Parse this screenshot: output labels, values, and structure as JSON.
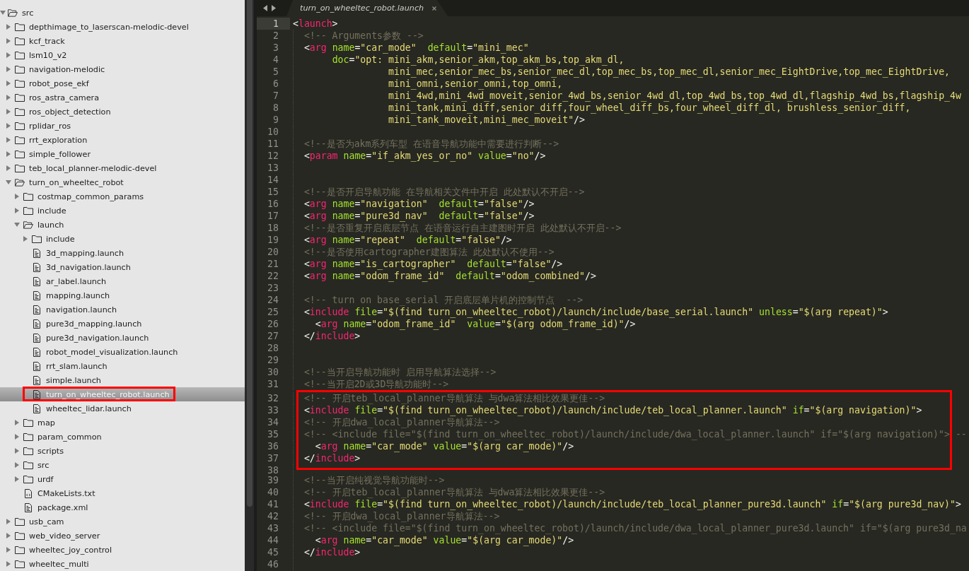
{
  "sidebar": {
    "items": [
      {
        "label": "src",
        "kind": "folder",
        "expanded": true,
        "selected": false,
        "highlighted": false,
        "children": [
          {
            "label": "depthimage_to_laserscan-melodic-devel",
            "kind": "folder",
            "expanded": false,
            "selected": false,
            "highlighted": false
          },
          {
            "label": "kcf_track",
            "kind": "folder",
            "expanded": false,
            "selected": false,
            "highlighted": false
          },
          {
            "label": "lsm10_v2",
            "kind": "folder",
            "expanded": false,
            "selected": false,
            "highlighted": false
          },
          {
            "label": "navigation-melodic",
            "kind": "folder",
            "expanded": false,
            "selected": false,
            "highlighted": false
          },
          {
            "label": "robot_pose_ekf",
            "kind": "folder",
            "expanded": false,
            "selected": false,
            "highlighted": false
          },
          {
            "label": "ros_astra_camera",
            "kind": "folder",
            "expanded": false,
            "selected": false,
            "highlighted": false
          },
          {
            "label": "ros_object_detection",
            "kind": "folder",
            "expanded": false,
            "selected": false,
            "highlighted": false
          },
          {
            "label": "rplidar_ros",
            "kind": "folder",
            "expanded": false,
            "selected": false,
            "highlighted": false
          },
          {
            "label": "rrt_exploration",
            "kind": "folder",
            "expanded": false,
            "selected": false,
            "highlighted": false
          },
          {
            "label": "simple_follower",
            "kind": "folder",
            "expanded": false,
            "selected": false,
            "highlighted": false
          },
          {
            "label": "teb_local_planner-melodic-devel",
            "kind": "folder",
            "expanded": false,
            "selected": false,
            "highlighted": false
          },
          {
            "label": "turn_on_wheeltec_robot",
            "kind": "folder",
            "expanded": true,
            "selected": false,
            "highlighted": false,
            "children": [
              {
                "label": "costmap_common_params",
                "kind": "folder",
                "expanded": false,
                "selected": false,
                "highlighted": false
              },
              {
                "label": "include",
                "kind": "folder",
                "expanded": false,
                "selected": false,
                "highlighted": false
              },
              {
                "label": "launch",
                "kind": "folder",
                "expanded": true,
                "selected": false,
                "highlighted": false,
                "children": [
                  {
                    "label": "include",
                    "kind": "folder",
                    "expanded": false,
                    "selected": false,
                    "highlighted": false
                  },
                  {
                    "label": "3d_mapping.launch",
                    "kind": "file",
                    "selected": false,
                    "highlighted": false
                  },
                  {
                    "label": "3d_navigation.launch",
                    "kind": "file",
                    "selected": false,
                    "highlighted": false
                  },
                  {
                    "label": "ar_label.launch",
                    "kind": "file",
                    "selected": false,
                    "highlighted": false
                  },
                  {
                    "label": "mapping.launch",
                    "kind": "file",
                    "selected": false,
                    "highlighted": false
                  },
                  {
                    "label": "navigation.launch",
                    "kind": "file",
                    "selected": false,
                    "highlighted": false
                  },
                  {
                    "label": "pure3d_mapping.launch",
                    "kind": "file",
                    "selected": false,
                    "highlighted": false
                  },
                  {
                    "label": "pure3d_navigation.launch",
                    "kind": "file",
                    "selected": false,
                    "highlighted": false
                  },
                  {
                    "label": "robot_model_visualization.launch",
                    "kind": "file",
                    "selected": false,
                    "highlighted": false
                  },
                  {
                    "label": "rrt_slam.launch",
                    "kind": "file",
                    "selected": false,
                    "highlighted": false
                  },
                  {
                    "label": "simple.launch",
                    "kind": "file",
                    "selected": false,
                    "highlighted": false
                  },
                  {
                    "label": "turn_on_wheeltec_robot.launch",
                    "kind": "file",
                    "selected": true,
                    "highlighted": true
                  },
                  {
                    "label": "wheeltec_lidar.launch",
                    "kind": "file",
                    "selected": false,
                    "highlighted": false
                  }
                ]
              },
              {
                "label": "map",
                "kind": "folder",
                "expanded": false,
                "selected": false,
                "highlighted": false
              },
              {
                "label": "param_common",
                "kind": "folder",
                "expanded": false,
                "selected": false,
                "highlighted": false
              },
              {
                "label": "scripts",
                "kind": "folder",
                "expanded": false,
                "selected": false,
                "highlighted": false
              },
              {
                "label": "src",
                "kind": "folder",
                "expanded": false,
                "selected": false,
                "highlighted": false
              },
              {
                "label": "urdf",
                "kind": "folder",
                "expanded": false,
                "selected": false,
                "highlighted": false
              },
              {
                "label": "CMakeLists.txt",
                "kind": "code-file",
                "selected": false,
                "highlighted": false
              },
              {
                "label": "package.xml",
                "kind": "file",
                "selected": false,
                "highlighted": false
              }
            ]
          },
          {
            "label": "usb_cam",
            "kind": "folder",
            "expanded": false,
            "selected": false,
            "highlighted": false
          },
          {
            "label": "web_video_server",
            "kind": "folder",
            "expanded": false,
            "selected": false,
            "highlighted": false
          },
          {
            "label": "wheeltec_joy_control",
            "kind": "folder",
            "expanded": false,
            "selected": false,
            "highlighted": false
          },
          {
            "label": "wheeltec_multi",
            "kind": "folder",
            "expanded": false,
            "selected": false,
            "highlighted": false
          }
        ]
      }
    ]
  },
  "editor": {
    "tabs": [
      {
        "title": "turn_on_wheeltec_robot.launch",
        "selected": true
      }
    ],
    "blocks": [
      {
        "highlighted": false,
        "lines": [
          {
            "number": "1",
            "kind": "code",
            "text": "<launch>",
            "current": true
          },
          {
            "number": "2",
            "kind": "comment",
            "text": "  <!-- Arguments参数 -->",
            "current": false
          },
          {
            "number": "3",
            "kind": "code",
            "text": "  <arg name=\"car_mode\"  default=\"mini_mec\"",
            "current": false
          },
          {
            "number": "4",
            "kind": "code",
            "text": "       doc=\"opt: mini_akm,senior_akm,top_akm_bs,top_akm_dl,",
            "current": false
          },
          {
            "number": "5",
            "kind": "code",
            "text": "                 mini_mec,senior_mec_bs,senior_mec_dl,top_mec_bs,top_mec_dl,senior_mec_EightDrive,top_mec_EightDrive,",
            "current": false
          },
          {
            "number": "6",
            "kind": "code",
            "text": "                 mini_omni,senior_omni,top_omni,",
            "current": false
          },
          {
            "number": "7",
            "kind": "code",
            "text": "                 mini_4wd,mini_4wd_moveit,senior_4wd_bs,senior_4wd_dl,top_4wd_bs,top_4wd_dl,flagship_4wd_bs,flagship_4w",
            "current": false
          },
          {
            "number": "8",
            "kind": "code",
            "text": "                 mini_tank,mini_diff,senior_diff,four_wheel_diff_bs,four_wheel_diff_dl, brushless_senior_diff,",
            "current": false
          },
          {
            "number": "9",
            "kind": "code",
            "text": "                 mini_tank_moveit,mini_mec_moveit\"/>",
            "current": false
          },
          {
            "number": "10",
            "kind": "blank",
            "current": false
          },
          {
            "number": "11",
            "kind": "comment",
            "text": "  <!--是否为akm系列车型 在语音导航功能中需要进行判断-->",
            "current": false
          },
          {
            "number": "12",
            "kind": "code",
            "text": "  <param name=\"if_akm_yes_or_no\" value=\"no\"/>",
            "current": false
          },
          {
            "number": "13",
            "kind": "blank",
            "current": false
          },
          {
            "number": "14",
            "kind": "blank",
            "current": false
          },
          {
            "number": "15",
            "kind": "comment",
            "text": "  <!--是否开启导航功能 在导航相关文件中开启 此处默认不开启-->",
            "current": false
          },
          {
            "number": "16",
            "kind": "code",
            "text": "  <arg name=\"navigation\"  default=\"false\"/>",
            "current": false
          },
          {
            "number": "17",
            "kind": "code",
            "text": "  <arg name=\"pure3d_nav\"  default=\"false\"/>",
            "current": false
          },
          {
            "number": "18",
            "kind": "comment",
            "text": "  <!--是否重复开启底层节点 在语音运行自主建图时开启 此处默认不开启-->",
            "current": false
          },
          {
            "number": "19",
            "kind": "code",
            "text": "  <arg name=\"repeat\"  default=\"false\"/>",
            "current": false
          },
          {
            "number": "20",
            "kind": "comment",
            "text": "  <!--是否使用cartographer建图算法 此处默认不使用-->",
            "current": false
          },
          {
            "number": "21",
            "kind": "code",
            "text": "  <arg name=\"is_cartographer\"  default=\"false\"/>",
            "current": false
          },
          {
            "number": "22",
            "kind": "code",
            "text": "  <arg name=\"odom_frame_id\"  default=\"odom_combined\"/>",
            "current": false
          },
          {
            "number": "23",
            "kind": "blank",
            "current": false
          },
          {
            "number": "24",
            "kind": "comment",
            "text": "  <!-- turn on base_serial 开启底层单片机的控制节点  -->",
            "current": false
          },
          {
            "number": "25",
            "kind": "code",
            "text": "  <include file=\"$(find turn_on_wheeltec_robot)/launch/include/base_serial.launch\" unless=\"$(arg repeat)\">",
            "current": false
          },
          {
            "number": "26",
            "kind": "code",
            "text": "    <arg name=\"odom_frame_id\"  value=\"$(arg odom_frame_id)\"/>",
            "current": false
          },
          {
            "number": "27",
            "kind": "code",
            "text": "  </include>",
            "current": false
          },
          {
            "number": "28",
            "kind": "blank",
            "current": false
          },
          {
            "number": "29",
            "kind": "blank",
            "current": false
          },
          {
            "number": "30",
            "kind": "comment",
            "text": "  <!--当开启导航功能时 启用导航算法选择-->",
            "current": false
          },
          {
            "number": "31",
            "kind": "comment",
            "text": "  <!--当开启2D或3D导航功能时-->",
            "current": false
          }
        ]
      },
      {
        "highlighted": true,
        "lines": [
          {
            "number": "32",
            "kind": "comment",
            "text": "  <!-- 开启teb_local_planner导航算法 与dwa算法相比效果更佳-->",
            "current": false
          },
          {
            "number": "33",
            "kind": "code",
            "text": "  <include file=\"$(find turn_on_wheeltec_robot)/launch/include/teb_local_planner.launch\" if=\"$(arg navigation)\">",
            "current": false
          },
          {
            "number": "34",
            "kind": "comment",
            "text": "  <!-- 开启dwa_local_planner导航算法-->",
            "current": false
          },
          {
            "number": "35",
            "kind": "comment",
            "text": "  <!-- <include file=\"$(find turn_on_wheeltec_robot)/launch/include/dwa_local_planner.launch\" if=\"$(arg navigation)\"> --",
            "current": false
          },
          {
            "number": "36",
            "kind": "code",
            "text": "    <arg name=\"car_mode\" value=\"$(arg car_mode)\"/>",
            "current": false
          },
          {
            "number": "37",
            "kind": "code",
            "text": "  </include>",
            "current": false
          },
          {
            "number": "38",
            "kind": "blank",
            "current": false
          }
        ]
      },
      {
        "highlighted": false,
        "lines": [
          {
            "number": "39",
            "kind": "comment",
            "text": "  <!--当开启纯视觉导航功能时-->",
            "current": false
          },
          {
            "number": "40",
            "kind": "comment",
            "text": "  <!-- 开启teb_local_planner导航算法 与dwa算法相比效果更佳-->",
            "current": false
          },
          {
            "number": "41",
            "kind": "code",
            "text": "  <include file=\"$(find turn_on_wheeltec_robot)/launch/include/teb_local_planner_pure3d.launch\" if=\"$(arg pure3d_nav)\">",
            "current": false
          },
          {
            "number": "42",
            "kind": "comment",
            "text": "  <!-- 开启dwa_local_planner导航算法-->",
            "current": false
          },
          {
            "number": "43",
            "kind": "comment",
            "text": "  <!-- <include file=\"$(find turn_on_wheeltec_robot)/launch/include/dwa_local_planner_pure3d.launch\" if=\"$(arg pure3d_na",
            "current": false
          },
          {
            "number": "44",
            "kind": "code",
            "text": "    <arg name=\"car_mode\" value=\"$(arg car_mode)\"/>",
            "current": false
          },
          {
            "number": "45",
            "kind": "code",
            "text": "  </include>",
            "current": false
          },
          {
            "number": "46",
            "kind": "blank",
            "current": false
          }
        ]
      }
    ]
  }
}
